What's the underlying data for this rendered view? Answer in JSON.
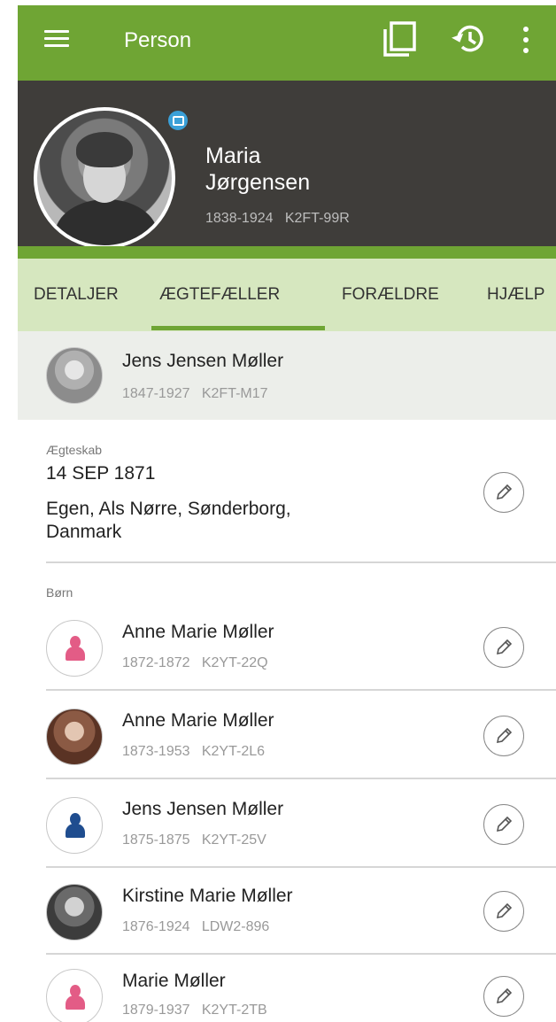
{
  "appbar": {
    "title": "Person",
    "icons": [
      "menu-icon",
      "copy-icon",
      "history-icon",
      "more-vert-icon"
    ]
  },
  "person": {
    "name": "Maria Jørgensen",
    "dates": "1838-1924",
    "id": "K2FT-99R",
    "meta": "1838-1924   K2FT-99R"
  },
  "tabs": [
    "DETALJER",
    "ÆGTEFÆLLER",
    "FORÆLDRE",
    "HJÆLP"
  ],
  "active_tab": "ÆGTEFÆLLER",
  "spouse": {
    "name": "Jens Jensen Møller",
    "meta": "1847-1927   K2FT-M17"
  },
  "marriage": {
    "label": "Ægteskab",
    "date": "14 SEP 1871",
    "place": "Egen, Als Nørre, Sønderborg, Danmark"
  },
  "children_label": "Børn",
  "children": [
    {
      "name": "Anne Marie Møller",
      "meta": "1872-1872   K2YT-22Q",
      "avatar": "female-icon"
    },
    {
      "name": "Anne Marie Møller",
      "meta": "1873-1953   K2YT-2L6",
      "avatar": "photo"
    },
    {
      "name": "Jens Jensen Møller",
      "meta": "1875-1875   K2YT-25V",
      "avatar": "male-icon"
    },
    {
      "name": "Kirstine Marie Møller",
      "meta": "1876-1924   LDW2-896",
      "avatar": "photo"
    },
    {
      "name": "Marie Møller",
      "meta": "1879-1937   K2YT-2TB",
      "avatar": "female-icon"
    }
  ],
  "colors": {
    "appbar": "#6fa534",
    "header": "#3f3d3a",
    "tabs": "#d6e7bf",
    "female": "#e35c86",
    "male": "#1f4d8f"
  }
}
